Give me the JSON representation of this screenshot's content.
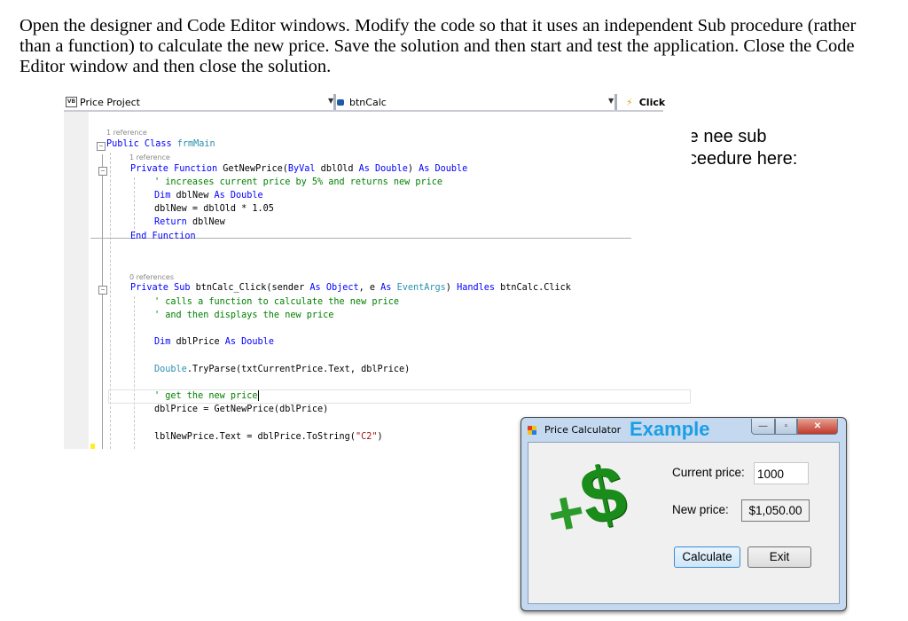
{
  "instructions": "Open the designer and Code Editor windows. Modify the code so that it uses an independent Sub procedure (rather than a function) to calculate the new price. Save the solution and then start and test the application. Close the Code Editor window and then close the solution.",
  "note": {
    "line1": "Wee nee sub",
    "line2": "proceedure here:"
  },
  "editor": {
    "project_dropdown": "Price Project",
    "object_dropdown": "btnCalc",
    "event_dropdown": "Click",
    "ref_class": "1 reference",
    "ref_function": "1 reference",
    "ref_sub": "0 references",
    "lines": {
      "class_kw": "Public Class",
      "class_name": "frmMain",
      "fn_private": "Private Function",
      "fn_sig": " GetNewPrice(",
      "fn_byval": "ByVal",
      "fn_param": " dblOld ",
      "fn_as1": "As Double",
      "fn_close": ") ",
      "fn_as2": "As Double",
      "fn_comment": "' increases current price by 5% and returns new price",
      "dim1_kw": "Dim",
      "dim1_var": " dblNew ",
      "dim1_type": "As Double",
      "assign1": "dblNew = dblOld * 1.05",
      "return_kw": "Return",
      "return_var": " dblNew",
      "end_function": "End Function",
      "sub_private": "Private Sub",
      "sub_name": " btnCalc_Click(sender ",
      "sub_as1": "As",
      "sub_obj": " Object",
      "sub_mid": ", e ",
      "sub_as2": "As",
      "sub_evt": " EventArgs",
      "sub_close": ") ",
      "sub_handles": "Handles",
      "sub_target": " btnCalc.Click",
      "sub_comment1": "' calls a function to calculate the new price",
      "sub_comment2": "' and then displays the new price",
      "dim2_kw": "Dim",
      "dim2_var": " dblPrice ",
      "dim2_type": "As Double",
      "tryparse_type": "Double",
      "tryparse_rest": ".TryParse(txtCurrentPrice.Text, dblPrice)",
      "comment_get": "' get the new price",
      "assign2": "dblPrice = GetNewPrice(dblPrice)",
      "lbl_assign": "lblNewPrice.Text = dblPrice.ToString(",
      "lbl_str": "\"C2\"",
      "lbl_close": ")"
    }
  },
  "calculator": {
    "title": "Price Calculator",
    "overlay_label": "Example",
    "current_price_label": "Current price:",
    "current_price_value": "1000",
    "new_price_label": "New price:",
    "new_price_value": "$1,050.00",
    "calculate_button": "Calculate",
    "exit_button": "Exit",
    "logo_plus": "+",
    "logo_dollar": "$",
    "minimize": "—",
    "maximize": "▫",
    "close": "✕"
  },
  "colors": {
    "keyword": "#0000ff",
    "type": "#2b91af",
    "comment": "#008000",
    "string": "#a31515",
    "example": "#1a9ee6",
    "logo_green": "#1a8c1a"
  }
}
